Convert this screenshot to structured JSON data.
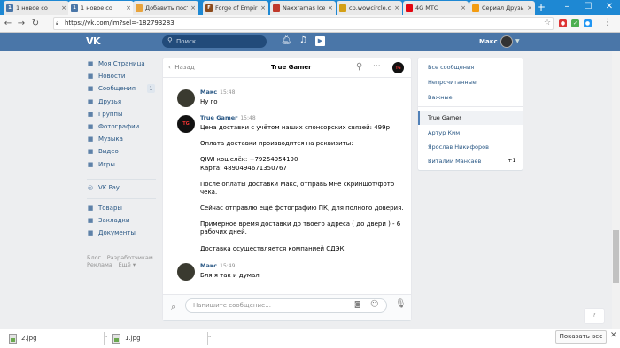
{
  "browser": {
    "tabs": [
      {
        "title": "1 новое со",
        "favicon_color": "#4a76a8",
        "favicon_text": "1",
        "active": false
      },
      {
        "title": "1 новое со",
        "favicon_color": "#4a76a8",
        "favicon_text": "1",
        "active": true
      },
      {
        "title": "Добавить пост",
        "favicon_color": "#e8a33c",
        "favicon_text": "",
        "active": false
      },
      {
        "title": "Forge of Empir",
        "favicon_color": "#8b4a1c",
        "favicon_text": "F",
        "active": false
      },
      {
        "title": "Naxxramas Ice",
        "favicon_color": "#c0392b",
        "favicon_text": "",
        "active": false
      },
      {
        "title": "cp.wowcircle.c",
        "favicon_color": "#d4a017",
        "favicon_text": "",
        "active": false
      },
      {
        "title": "4G МТС",
        "favicon_color": "#e30611",
        "favicon_text": "",
        "active": false
      },
      {
        "title": "Сериал Друзья",
        "favicon_color": "#f39c12",
        "favicon_text": "",
        "active": false
      }
    ],
    "url": "https://vk.com/im?sel=-182793283"
  },
  "vk_header": {
    "logo": "VK",
    "search_placeholder": "Поиск",
    "username": "Макс"
  },
  "left_nav": {
    "items": [
      {
        "label": "Моя Страница",
        "icon": "home-icon"
      },
      {
        "label": "Новости",
        "icon": "news-icon"
      },
      {
        "label": "Сообщения",
        "icon": "messages-icon"
      },
      {
        "label": "Друзья",
        "icon": "friends-icon"
      },
      {
        "label": "Группы",
        "icon": "groups-icon"
      },
      {
        "label": "Фотографии",
        "icon": "photos-icon"
      },
      {
        "label": "Музыка",
        "icon": "music-icon"
      },
      {
        "label": "Видео",
        "icon": "video-icon"
      },
      {
        "label": "Игры",
        "icon": "games-icon"
      }
    ],
    "messages_count": "1",
    "vkpay": "VK Pay",
    "secondary": [
      {
        "label": "Товары",
        "icon": "goods-icon"
      },
      {
        "label": "Закладки",
        "icon": "bookmarks-icon"
      },
      {
        "label": "Документы",
        "icon": "documents-icon"
      }
    ],
    "footer": [
      "Блог",
      "Разработчикам",
      "Реклама",
      "Ещё"
    ]
  },
  "chat": {
    "back_label": "Назад",
    "title": "True Gamer",
    "avatar_text": "TG",
    "messages": [
      {
        "author": "Макс",
        "time": "15:48",
        "lines": [
          "Ну го"
        ]
      },
      {
        "author": "True Gamer",
        "time": "15:48",
        "lines": [
          "Цена доставки с учётом наших спонсорских связей: 499р",
          "",
          "Оплата доставки производится на реквизиты:",
          "",
          "QIWI кошелёк: +79254954190",
          "Карта: 4890494671350767",
          "",
          "После оплаты доставки Макс, отправь мне скриншот/фото",
          "чека.",
          "",
          "Сейчас отправлю ещё фотографию ПК, для полного доверия.",
          "",
          "Примерное время доставки до твоего адреса ( до двери ) - 6",
          "рабочих дней.",
          "",
          "Доставка осуществляется компанией СДЭК"
        ]
      },
      {
        "author": "Макс",
        "time": "15:49",
        "lines": [
          "Бля я так и думал"
        ]
      }
    ],
    "input_placeholder": "Напишите сообщение..."
  },
  "right_panel": {
    "filters": [
      "Все сообщения",
      "Непрочитанные",
      "Важные"
    ],
    "dialogs": [
      {
        "name": "True Gamer",
        "active": true,
        "count": ""
      },
      {
        "name": "Артур Ким",
        "active": false,
        "count": ""
      },
      {
        "name": "Ярослав Никифоров",
        "active": false,
        "count": ""
      },
      {
        "name": "Виталий Мансаев",
        "active": false,
        "count": "+1"
      }
    ]
  },
  "help_badge": "?",
  "downloads": {
    "files": [
      "2.jpg",
      "1.jpg"
    ],
    "show_all": "Показать все"
  }
}
